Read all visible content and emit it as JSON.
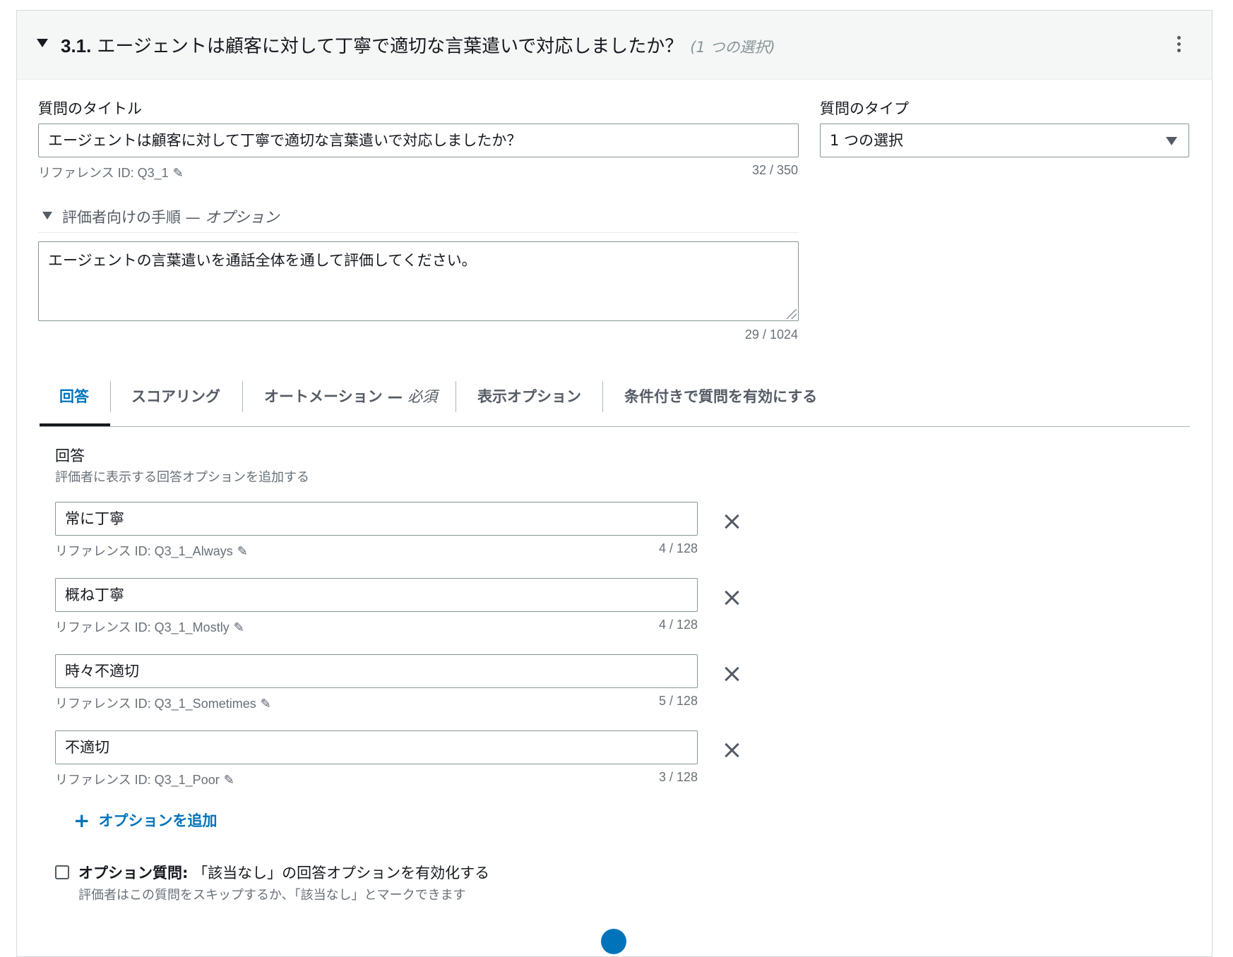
{
  "question": {
    "number": "3.1.",
    "title": "エージェントは顧客に対して丁寧で適切な言葉遣いで対応しましたか？",
    "type_hint": "(1 つの選択)"
  },
  "form": {
    "title_label": "質問のタイトル",
    "title_value": "エージェントは顧客に対して丁寧で適切な言葉遣いで対応しましたか？",
    "title_ref": "リファレンス ID: Q3_1",
    "title_count": "32 / 350",
    "type_label": "質問のタイプ",
    "type_value": "1 つの選択",
    "instructions_label": "評価者向けの手順 —",
    "instructions_optional": "オプション",
    "instructions_value": "エージェントの言葉遣いを通話全体を通して評価してください。",
    "instructions_count": "29 / 1024"
  },
  "tabs": [
    {
      "label": "回答",
      "suffix": ""
    },
    {
      "label": "スコアリング",
      "suffix": ""
    },
    {
      "label": "オートメーション —",
      "suffix": "必須"
    },
    {
      "label": "表示オプション",
      "suffix": ""
    },
    {
      "label": "条件付きで質問を有効にする",
      "suffix": ""
    }
  ],
  "answers": {
    "title": "回答",
    "description": "評価者に表示する回答オプションを追加する",
    "options": [
      {
        "value": "常に丁寧",
        "ref": "リファレンス ID: Q3_1_Always",
        "count": "4 / 128"
      },
      {
        "value": "概ね丁寧",
        "ref": "リファレンス ID: Q3_1_Mostly",
        "count": "4 / 128"
      },
      {
        "value": "時々不適切",
        "ref": "リファレンス ID: Q3_1_Sometimes",
        "count": "5 / 128"
      },
      {
        "value": "不適切",
        "ref": "リファレンス ID: Q3_1_Poor",
        "count": "3 / 128"
      }
    ],
    "add_label": "オプションを追加"
  },
  "optional_question": {
    "bold": "オプション質問:",
    "label": "「該当なし」の回答オプションを有効化する",
    "description": "評価者はこの質問をスキップするか、「該当なし」とマークできます"
  },
  "colors": {
    "accent": "#0073bb",
    "header_bg": "#f5f6f6",
    "border": "#879596"
  }
}
